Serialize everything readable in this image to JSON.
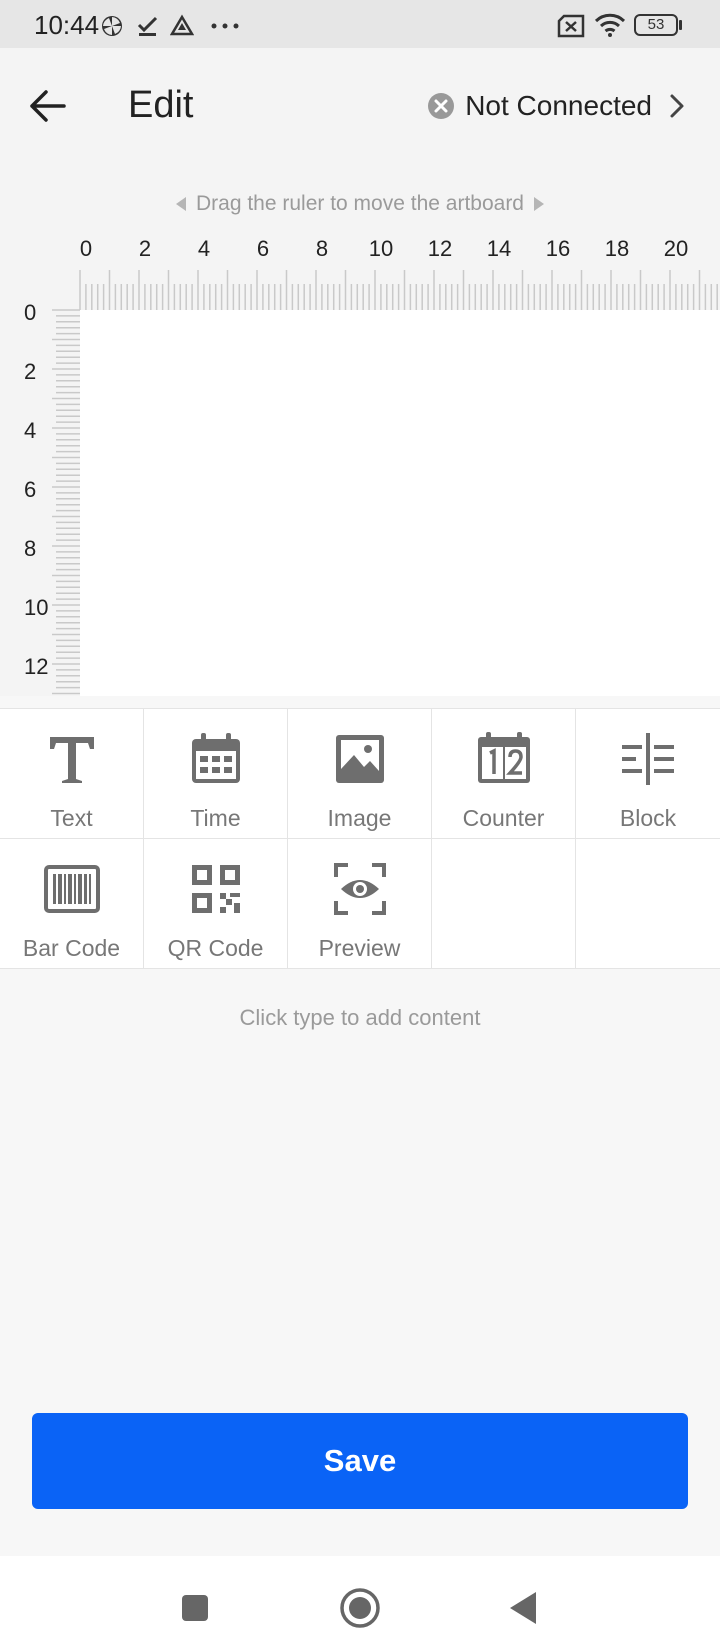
{
  "status_bar": {
    "time": "10:44",
    "battery": "53",
    "icons": [
      "pinwheel-icon",
      "check-icon",
      "triangle-icon",
      "more-icon",
      "sim-x-icon",
      "wifi-icon",
      "battery-icon"
    ]
  },
  "header": {
    "title": "Edit",
    "connection_label": "Not Connected"
  },
  "canvas": {
    "hint": "Drag the ruler to move the artboard",
    "ruler_x_labels": [
      "0",
      "2",
      "4",
      "6",
      "8",
      "10",
      "12",
      "14",
      "16",
      "18",
      "20"
    ],
    "ruler_y_labels": [
      "0",
      "2",
      "4",
      "6",
      "8",
      "10",
      "12"
    ]
  },
  "tools": {
    "row1": [
      {
        "label": "Text",
        "icon": "text-icon"
      },
      {
        "label": "Time",
        "icon": "calendar-icon"
      },
      {
        "label": "Image",
        "icon": "image-icon"
      },
      {
        "label": "Counter",
        "icon": "counter-icon"
      },
      {
        "label": "Block",
        "icon": "block-icon"
      }
    ],
    "row2": [
      {
        "label": "Bar Code",
        "icon": "barcode-icon"
      },
      {
        "label": "QR Code",
        "icon": "qrcode-icon"
      },
      {
        "label": "Preview",
        "icon": "preview-icon"
      }
    ]
  },
  "add_hint": "Click type to add content",
  "save_label": "Save",
  "colors": {
    "accent": "#0a63f6",
    "icon_gray": "#6e6e6e",
    "background": "#f7f7f7"
  }
}
